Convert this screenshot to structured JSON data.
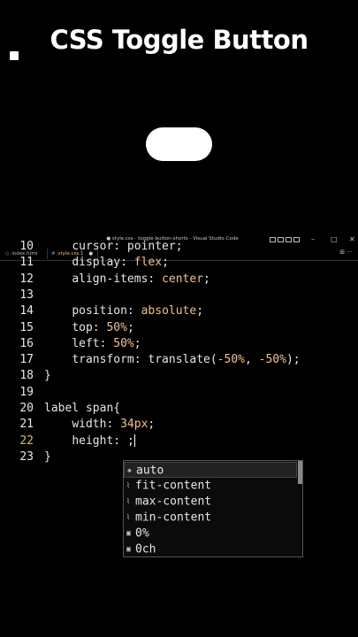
{
  "heading": "CSS Toggle Button",
  "window": {
    "title": "● style.css - toggle-button-shorts - Visual Studio Code",
    "minimize": "–",
    "maximize": "□",
    "close": "✕"
  },
  "tabs": [
    {
      "label": "index.html",
      "icon": "◇"
    },
    {
      "label": "style.css  1",
      "icon": "#",
      "close": "●"
    }
  ],
  "tabbar_icons": "⊞  ···",
  "editor": {
    "lines": [
      {
        "num": "10",
        "indent": "    ",
        "tokens": [
          {
            "t": "cursor: pointer;",
            "c": "prop"
          }
        ]
      },
      {
        "num": "11",
        "indent": "    ",
        "tokens": [
          {
            "t": "display: ",
            "c": "prop"
          },
          {
            "t": "flex",
            "c": "val"
          },
          {
            "t": ";",
            "c": "punc"
          }
        ]
      },
      {
        "num": "12",
        "indent": "    ",
        "tokens": [
          {
            "t": "align-items: ",
            "c": "prop"
          },
          {
            "t": "center",
            "c": "val"
          },
          {
            "t": ";",
            "c": "punc"
          }
        ]
      },
      {
        "num": "13",
        "indent": "",
        "tokens": []
      },
      {
        "num": "14",
        "indent": "    ",
        "tokens": [
          {
            "t": "position: ",
            "c": "prop"
          },
          {
            "t": "absolute",
            "c": "val"
          },
          {
            "t": ";",
            "c": "punc"
          }
        ]
      },
      {
        "num": "15",
        "indent": "    ",
        "tokens": [
          {
            "t": "top: ",
            "c": "prop"
          },
          {
            "t": "50%",
            "c": "num"
          },
          {
            "t": ";",
            "c": "punc"
          }
        ]
      },
      {
        "num": "16",
        "indent": "    ",
        "tokens": [
          {
            "t": "left: ",
            "c": "prop"
          },
          {
            "t": "50%",
            "c": "num"
          },
          {
            "t": ";",
            "c": "punc"
          }
        ]
      },
      {
        "num": "17",
        "indent": "    ",
        "tokens": [
          {
            "t": "transform: translate(",
            "c": "prop"
          },
          {
            "t": "-50%",
            "c": "num"
          },
          {
            "t": ", ",
            "c": "punc"
          },
          {
            "t": "-50%",
            "c": "num"
          },
          {
            "t": ");",
            "c": "punc"
          }
        ]
      },
      {
        "num": "18",
        "indent": "",
        "tokens": [
          {
            "t": "}",
            "c": "punc"
          }
        ]
      },
      {
        "num": "19",
        "indent": "",
        "tokens": []
      },
      {
        "num": "20",
        "indent": "",
        "tokens": [
          {
            "t": "label span{",
            "c": "sel"
          }
        ]
      },
      {
        "num": "21",
        "indent": "    ",
        "tokens": [
          {
            "t": "width: ",
            "c": "prop"
          },
          {
            "t": "34px",
            "c": "num"
          },
          {
            "t": ";",
            "c": "punc"
          }
        ]
      },
      {
        "num": "22",
        "indent": "    ",
        "tokens": [
          {
            "t": "height: ",
            "c": "prop"
          },
          {
            "t": ";",
            "c": "punc"
          }
        ],
        "current": true
      },
      {
        "num": "23",
        "indent": "",
        "tokens": [
          {
            "t": "}",
            "c": "punc"
          }
        ]
      }
    ]
  },
  "suggestions": [
    {
      "label": "auto",
      "icon": "◈"
    },
    {
      "label": "fit-content",
      "icon": "⌇"
    },
    {
      "label": "max-content",
      "icon": "⌇"
    },
    {
      "label": "min-content",
      "icon": "⌇"
    },
    {
      "label": "0%",
      "icon": "▣"
    },
    {
      "label": "0ch",
      "icon": "▣"
    }
  ]
}
